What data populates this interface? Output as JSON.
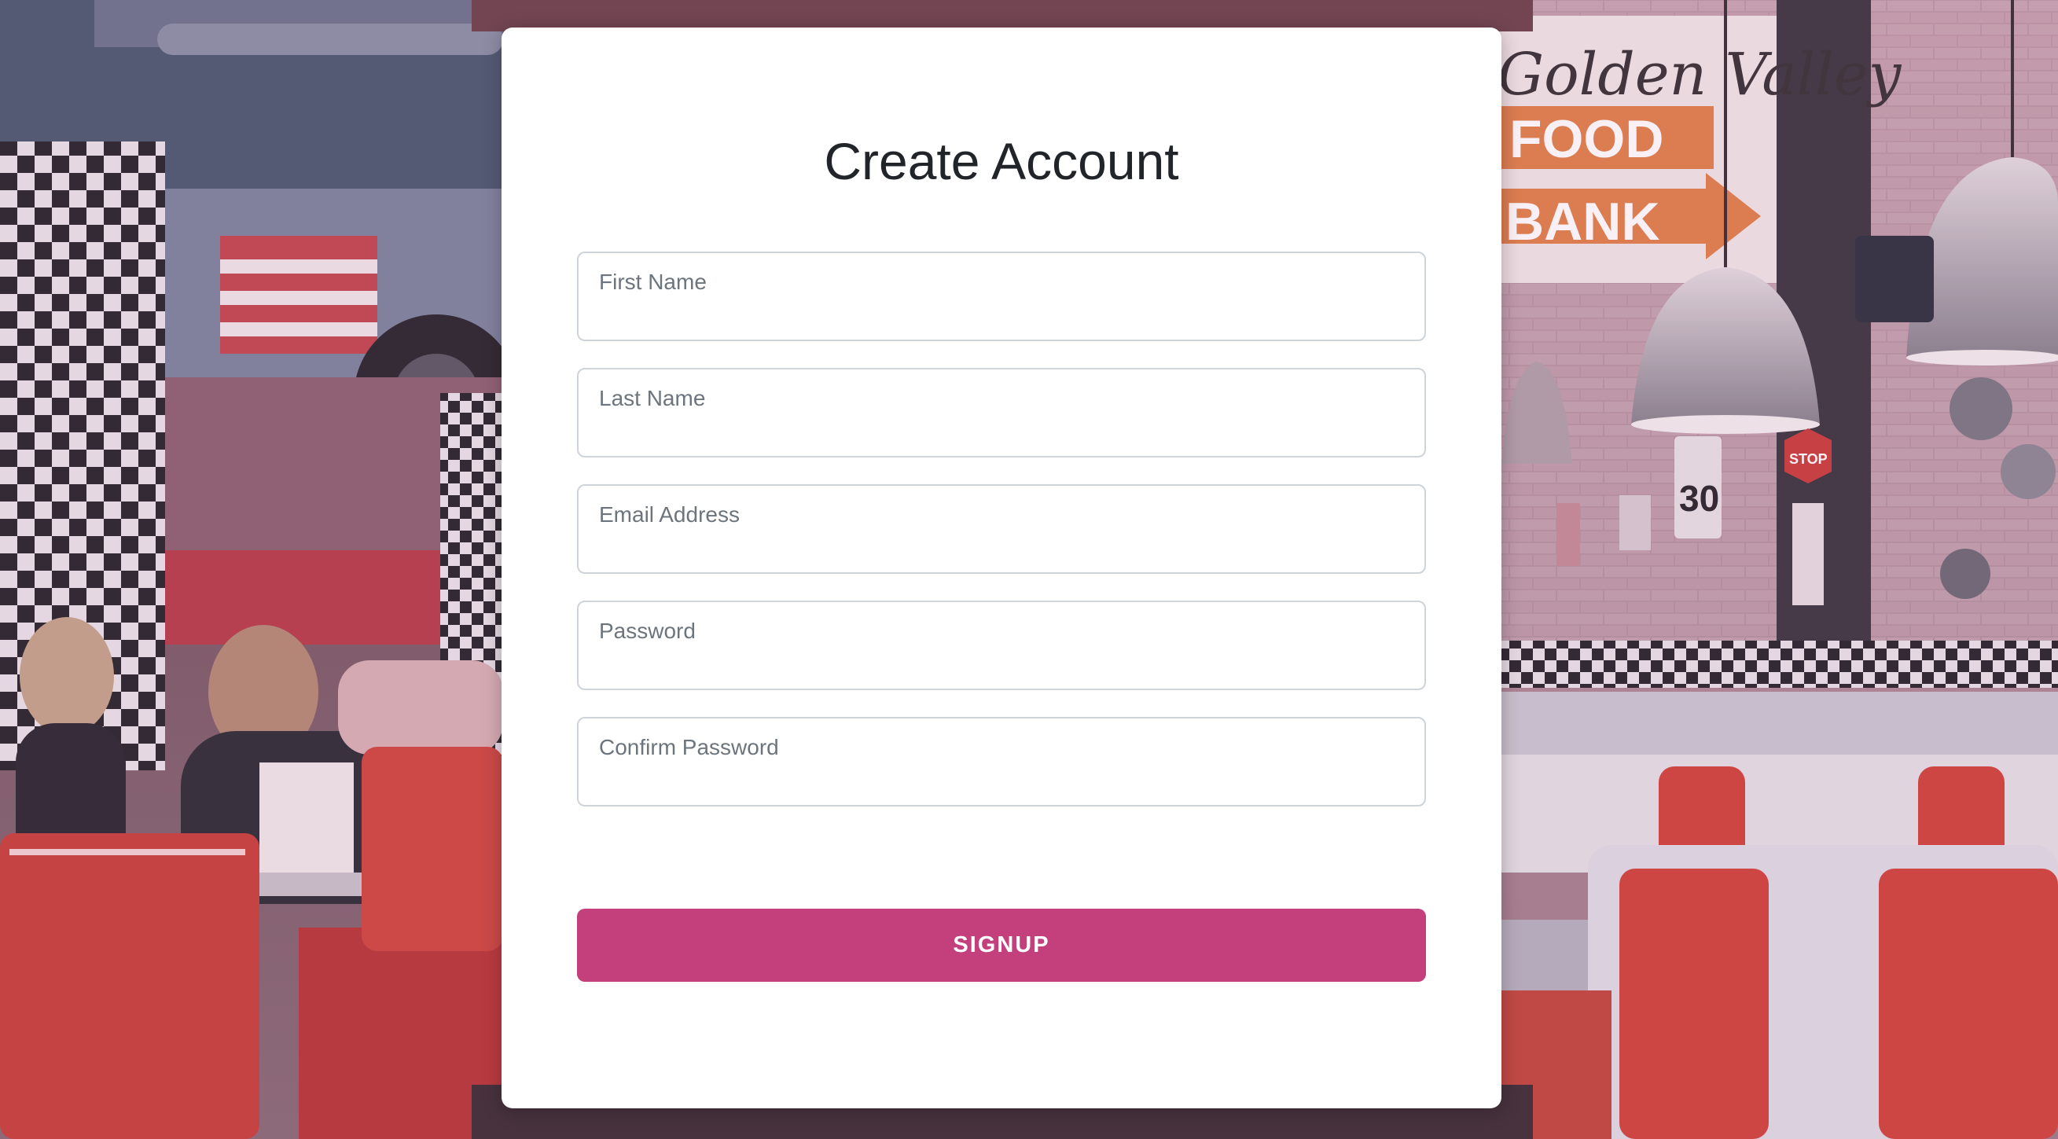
{
  "form": {
    "title": "Create Account",
    "fields": [
      {
        "label": "First Name",
        "value": ""
      },
      {
        "label": "Last Name",
        "value": ""
      },
      {
        "label": "Email Address",
        "value": ""
      },
      {
        "label": "Password",
        "value": ""
      },
      {
        "label": "Confirm Password",
        "value": ""
      }
    ],
    "submit_label": "SIGNUP"
  },
  "background": {
    "scene": "retro diner interior",
    "sign_line1": "Golden Valley",
    "sign_line2": "FOOD",
    "sign_line3": "BANK",
    "speed_sign": "30",
    "stop_sign": "STOP"
  },
  "colors": {
    "accent": "#c4407d",
    "card": "#ffffff",
    "title": "#212529",
    "label": "#6c757d",
    "field_border": "#ced4da"
  }
}
